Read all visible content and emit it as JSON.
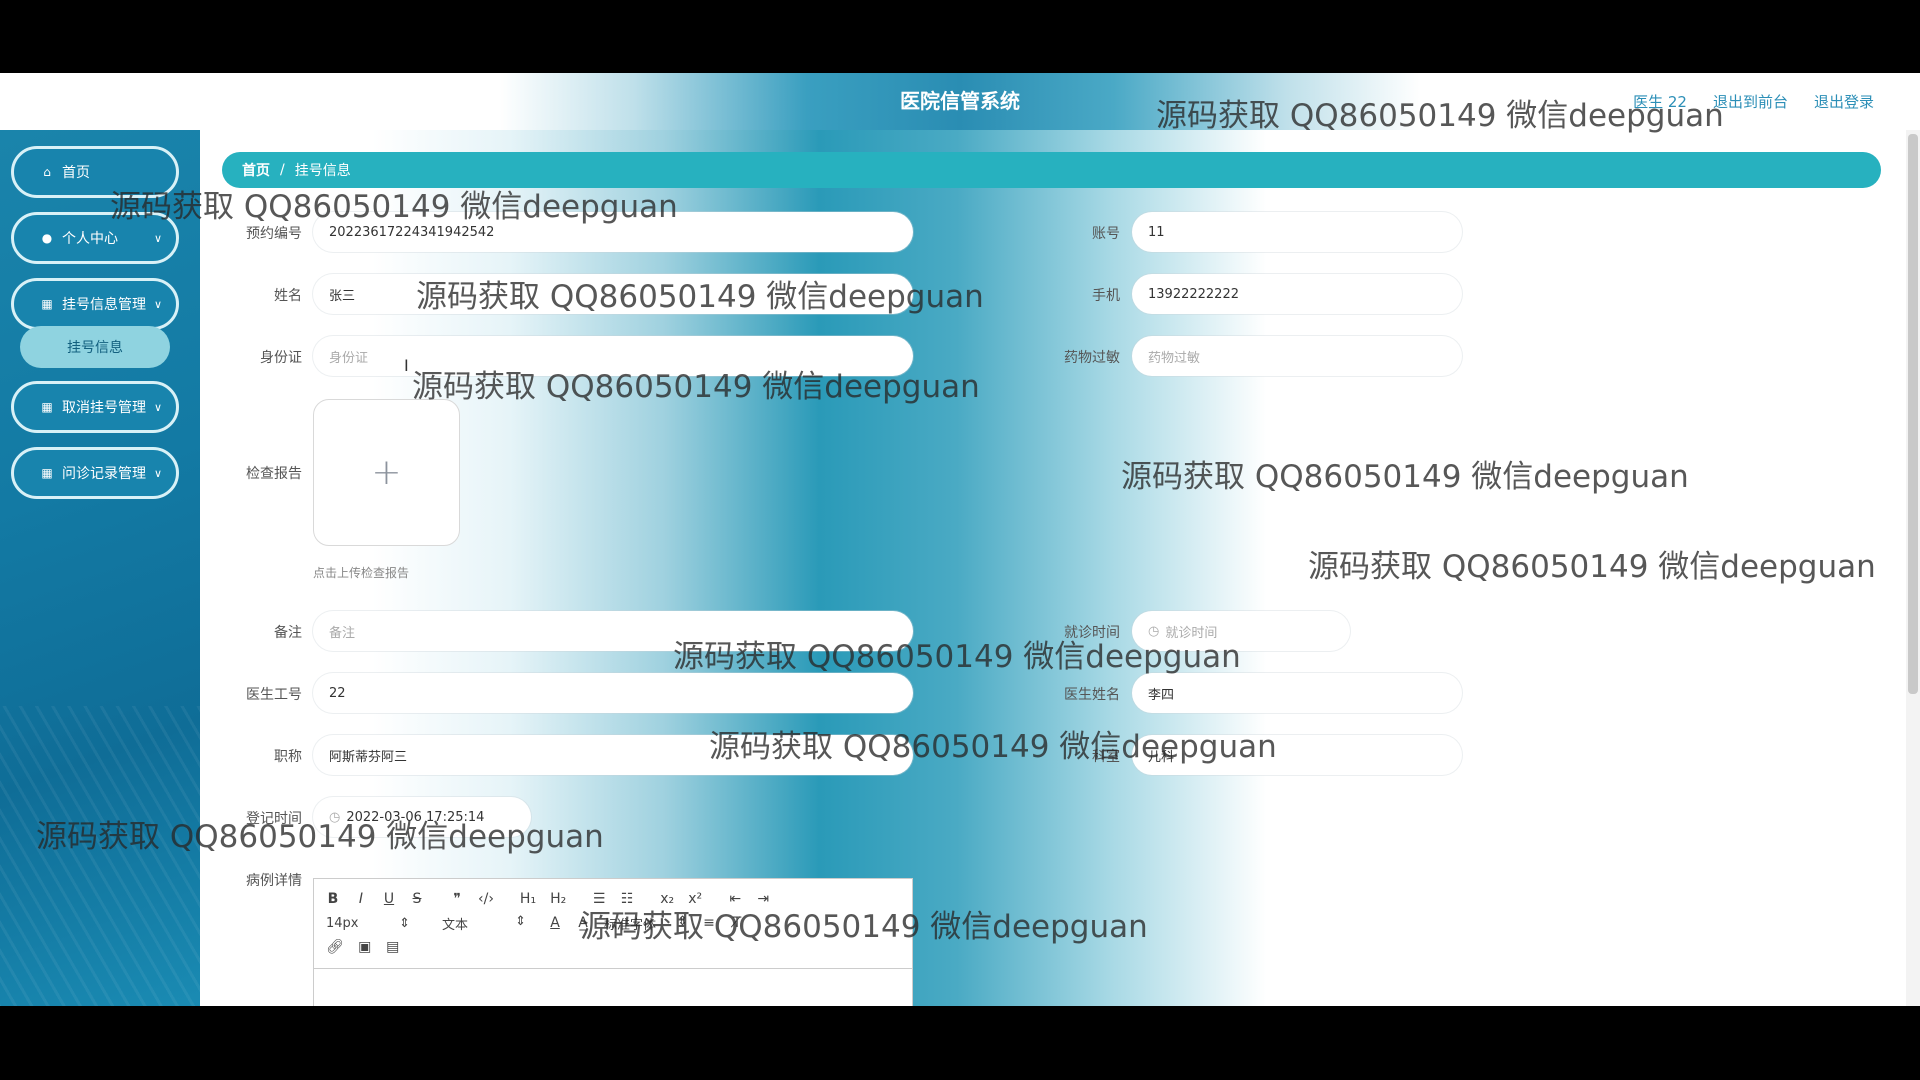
{
  "header": {
    "title": "医院信管系统",
    "user_link": "医生 22",
    "front_link": "退出到前台",
    "logout_link": "退出登录"
  },
  "sidebar": {
    "items": [
      {
        "label": "首页",
        "icon": "home-icon"
      },
      {
        "label": "个人中心",
        "icon": "user-icon"
      },
      {
        "label": "挂号信息管理",
        "icon": "grid-icon"
      },
      {
        "label": "取消挂号管理",
        "icon": "grid-icon"
      },
      {
        "label": "问诊记录管理",
        "icon": "grid-icon"
      }
    ],
    "submenu_label": "挂号信息"
  },
  "breadcrumb": {
    "home": "首页",
    "sep": "/",
    "current": "挂号信息"
  },
  "form": {
    "booking_no": {
      "label": "预约编号",
      "value": "20223617224341942542"
    },
    "account": {
      "label": "账号",
      "value": "11"
    },
    "name": {
      "label": "姓名",
      "value": "张三"
    },
    "phone": {
      "label": "手机",
      "value": "13922222222"
    },
    "id_card": {
      "label": "身份证",
      "placeholder": "身份证"
    },
    "allergy": {
      "label": "药物过敏",
      "placeholder": "药物过敏"
    },
    "report": {
      "label": "检查报告",
      "hint": "点击上传检查报告"
    },
    "remark": {
      "label": "备注",
      "placeholder": "备注"
    },
    "visit_time": {
      "label": "就诊时间",
      "placeholder": "就诊时间"
    },
    "doctor_no": {
      "label": "医生工号",
      "value": "22"
    },
    "doctor_name": {
      "label": "医生姓名",
      "value": "李四"
    },
    "title": {
      "label": "职称",
      "value": "阿斯蒂芬阿三"
    },
    "department": {
      "label": "科室",
      "value": "儿科"
    },
    "register_time": {
      "label": "登记时间",
      "value": "2022-03-06 17:25:14"
    },
    "case_detail": {
      "label": "病例详情"
    }
  },
  "editor": {
    "font_size": "14px",
    "text_type": "文本",
    "font_family": "标准字体"
  },
  "watermark_text": "源码获取 QQ86050149 微信deepguan"
}
